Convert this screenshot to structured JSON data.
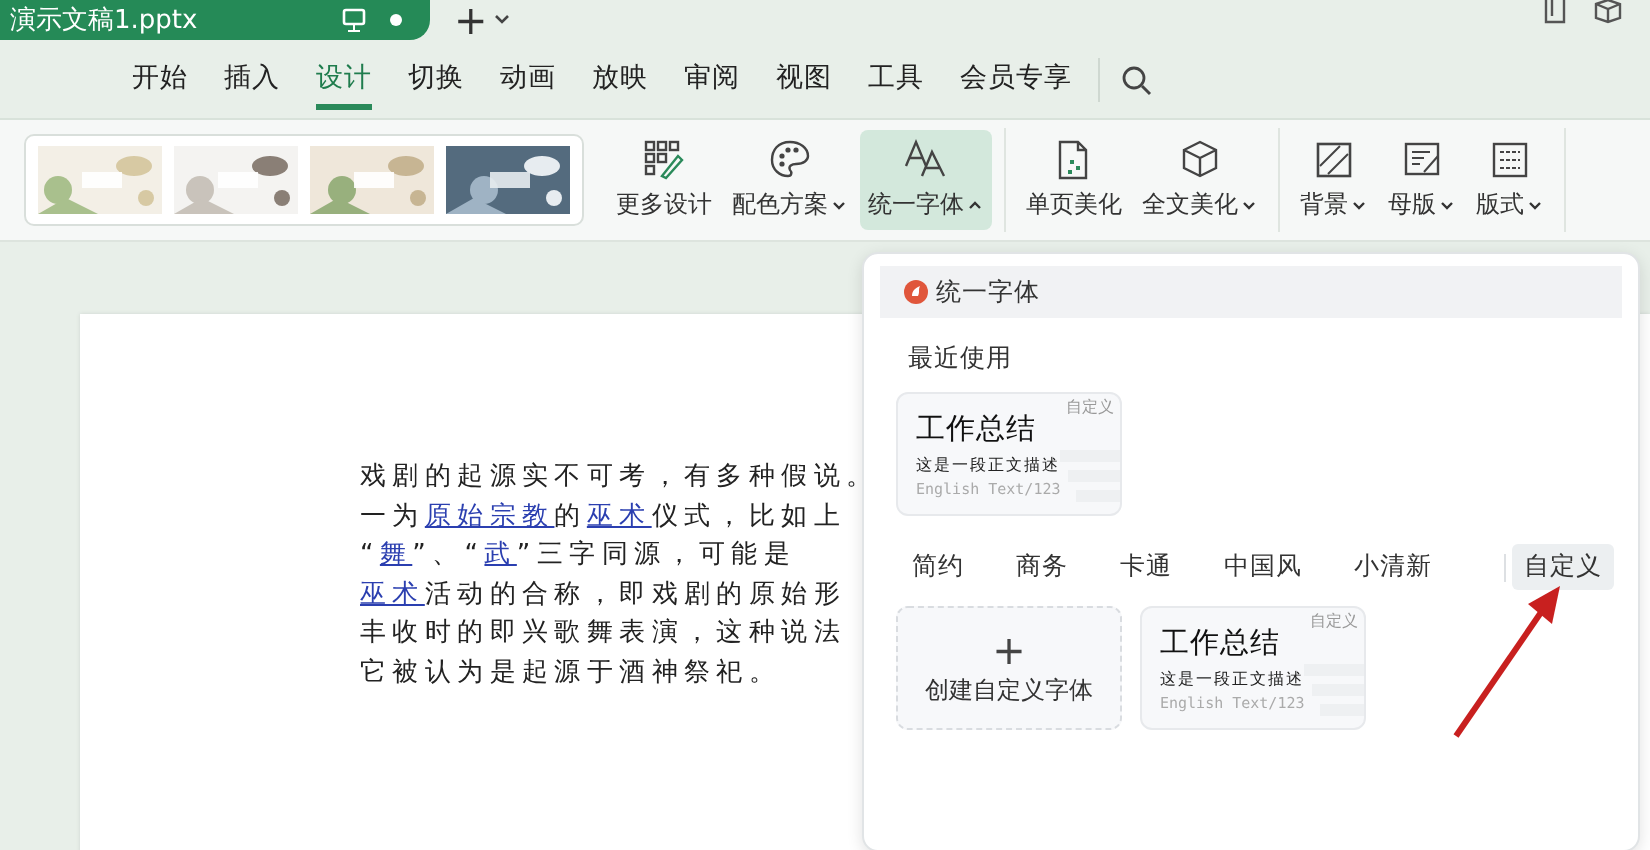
{
  "title_bar": {
    "document_tab": "演示文稿1.pptx",
    "new_tab": "+"
  },
  "menu_tabs": [
    {
      "label": "开始",
      "selected": false
    },
    {
      "label": "插入",
      "selected": false
    },
    {
      "label": "设计",
      "selected": true
    },
    {
      "label": "切换",
      "selected": false
    },
    {
      "label": "动画",
      "selected": false
    },
    {
      "label": "放映",
      "selected": false
    },
    {
      "label": "审阅",
      "selected": false
    },
    {
      "label": "视图",
      "selected": false
    },
    {
      "label": "工具",
      "selected": false
    },
    {
      "label": "会员专享",
      "selected": false
    }
  ],
  "ribbon": {
    "templates": [
      {
        "kind": "picture"
      },
      {
        "kind": "picture"
      },
      {
        "kind": "picture"
      },
      {
        "kind": "picture"
      }
    ],
    "groups": [
      [
        {
          "label": "更多设计",
          "dropdown": false,
          "selected": false
        },
        {
          "label": "配色方案",
          "dropdown": true,
          "expanded": false,
          "selected": false
        },
        {
          "label": "统一字体",
          "dropdown": true,
          "expanded": true,
          "selected": true
        }
      ],
      [
        {
          "label": "单页美化",
          "dropdown": false,
          "selected": false
        },
        {
          "label": "全文美化",
          "dropdown": true,
          "expanded": false,
          "selected": false
        }
      ],
      [
        {
          "label": "背景",
          "dropdown": true,
          "expanded": false,
          "selected": false
        },
        {
          "label": "母版",
          "dropdown": true,
          "expanded": false,
          "selected": false
        },
        {
          "label": "版式",
          "dropdown": true,
          "expanded": false,
          "selected": false
        }
      ]
    ]
  },
  "slide": {
    "lines": [
      [
        {
          "text": "戏剧的起源实不可考，有多种假说。",
          "link": false
        }
      ],
      [
        {
          "text": "一为",
          "link": false
        },
        {
          "text": "原始宗教",
          "link": true
        },
        {
          "text": "的",
          "link": false
        },
        {
          "text": "巫术",
          "link": true
        },
        {
          "text": "仪式，比如上",
          "link": false
        }
      ],
      [
        {
          "text": "“",
          "link": false
        },
        {
          "text": "舞",
          "link": true
        },
        {
          "text": "”、“",
          "link": false
        },
        {
          "text": "武",
          "link": true
        },
        {
          "text": "”三字同源，可能是",
          "link": false
        }
      ],
      [
        {
          "text": "巫术",
          "link": true
        },
        {
          "text": "活动的合称，即戏剧的原始形",
          "link": false
        }
      ],
      [
        {
          "text": "丰收时的即兴歌舞表演，这种说法",
          "link": false
        }
      ],
      [
        {
          "text": "它被认为是起源于酒神祭祀。",
          "link": false
        }
      ]
    ]
  },
  "font_panel": {
    "title": "统一字体",
    "recent_heading": "最近使用",
    "recent": [
      {
        "title": "工作总结",
        "sample": "这是一段正文描述",
        "english": "English Text/123",
        "badge": "自定义"
      }
    ],
    "categories": [
      {
        "label": "简约",
        "selected": false
      },
      {
        "label": "商务",
        "selected": false
      },
      {
        "label": "卡通",
        "selected": false
      },
      {
        "label": "中国风",
        "selected": false
      },
      {
        "label": "小清新",
        "selected": false
      },
      {
        "label": "自定义",
        "selected": true
      }
    ],
    "create_card": {
      "icon": "+",
      "label": "创建自定义字体"
    },
    "cards": [
      {
        "title": "工作总结",
        "sample": "这是一段正文描述",
        "english": "English Text/123",
        "badge": "自定义"
      }
    ]
  }
}
